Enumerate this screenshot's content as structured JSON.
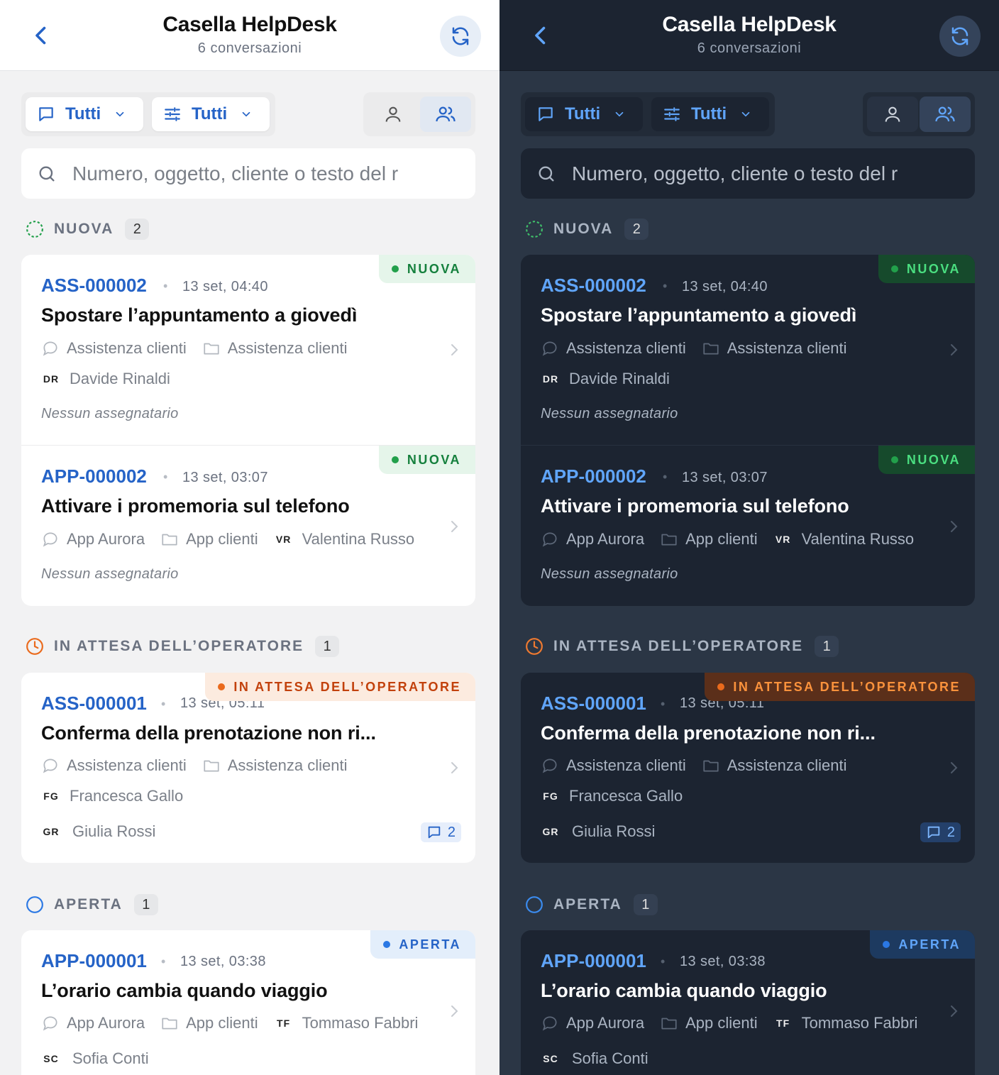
{
  "header": {
    "title": "Casella HelpDesk",
    "subtitle": "6 conversazioni"
  },
  "filters": {
    "channel_label": "Tutti",
    "category_label": "Tutti"
  },
  "search": {
    "placeholder": "Numero, oggetto, cliente o testo del r"
  },
  "sections": {
    "nuova": {
      "title": "NUOVA",
      "count": "2"
    },
    "attesa": {
      "title": "IN ATTESA DELL’OPERATORE",
      "count": "1"
    },
    "aperta": {
      "title": "APERTA",
      "count": "1"
    }
  },
  "tickets": {
    "t1": {
      "number": "ASS-000002",
      "date": "13 set, 04:40",
      "subject": "Spostare l’appuntamento a giovedì",
      "channel": "Assistenza clienti",
      "queue": "Assistenza clienti",
      "customer_initials": "DR",
      "customer": "Davide Rinaldi",
      "assignee": "Nessun assegnatario",
      "badge": "NUOVA"
    },
    "t2": {
      "number": "APP-000002",
      "date": "13 set, 03:07",
      "subject": "Attivare i promemoria sul telefono",
      "channel": "App Aurora",
      "queue": "App clienti",
      "customer_initials": "VR",
      "customer": "Valentina Russo",
      "assignee": "Nessun assegnatario",
      "badge": "NUOVA"
    },
    "t3": {
      "number": "ASS-000001",
      "date": "13 set, 05:11",
      "subject": "Conferma della prenotazione non ri...",
      "channel": "Assistenza clienti",
      "queue": "Assistenza clienti",
      "customer_initials": "FG",
      "customer": "Francesca Gallo",
      "assignee_initials": "GR",
      "assignee": "Giulia Rossi",
      "messages": "2",
      "badge": "IN ATTESA DELL’OPERATORE"
    },
    "t4": {
      "number": "APP-000001",
      "date": "13 set, 03:38",
      "subject": "L’orario cambia quando viaggio",
      "channel": "App Aurora",
      "queue": "App clienti",
      "customer_initials": "TF",
      "customer": "Tommaso Fabbri",
      "assignee_initials": "SC",
      "assignee": "Sofia Conti",
      "badge": "APERTA"
    }
  },
  "colors": {
    "accent": "#2563c7",
    "new": "#15803d",
    "waiting": "#c2410c",
    "open": "#2563c7"
  },
  "icons": [
    "chevron-left-icon",
    "refresh-icon",
    "chat-bubble-icon",
    "sliders-icon",
    "chevron-down-icon",
    "user-icon",
    "users-icon",
    "search-icon",
    "folder-icon",
    "chevron-right-icon",
    "message-icon"
  ]
}
